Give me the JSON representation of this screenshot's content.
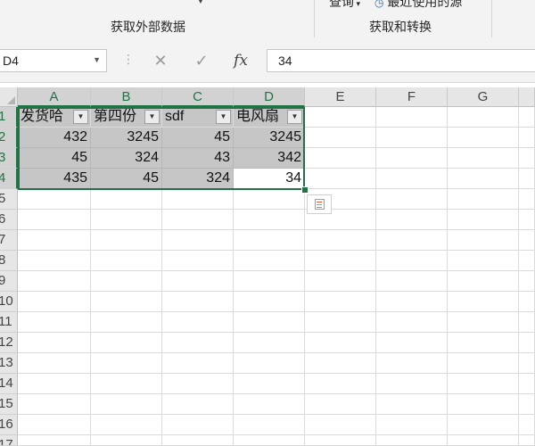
{
  "ribbon": {
    "group_external": "获取外部数据",
    "group_transform": "获取和转换",
    "query_label": "查询",
    "recent_sources_label": "最近使用的源"
  },
  "formula_bar": {
    "name_box": "D4",
    "formula_value": "34",
    "cancel_symbol": "✕",
    "enter_symbol": "✓",
    "fx_symbol": "fx"
  },
  "sheet": {
    "columns": [
      "A",
      "B",
      "C",
      "D",
      "E",
      "F",
      "G"
    ],
    "rows": [
      "1",
      "2",
      "3",
      "4",
      "5",
      "6",
      "7",
      "8",
      "9",
      "10",
      "11",
      "12",
      "13",
      "14",
      "15",
      "16",
      "17"
    ],
    "table": {
      "headers": [
        "发货哈",
        "第四份",
        "sdf",
        "电风扇"
      ],
      "data": [
        [
          "432",
          "3245",
          "45",
          "3245"
        ],
        [
          "45",
          "324",
          "43",
          "342"
        ],
        [
          "435",
          "45",
          "324",
          "34"
        ]
      ]
    },
    "selected_cell": "D4",
    "selection_color": "#217346",
    "table_shade": "#c6c6c6"
  },
  "icons": [
    "filter-dropdown-icon",
    "quick-analysis-icon",
    "select-all-icon"
  ]
}
